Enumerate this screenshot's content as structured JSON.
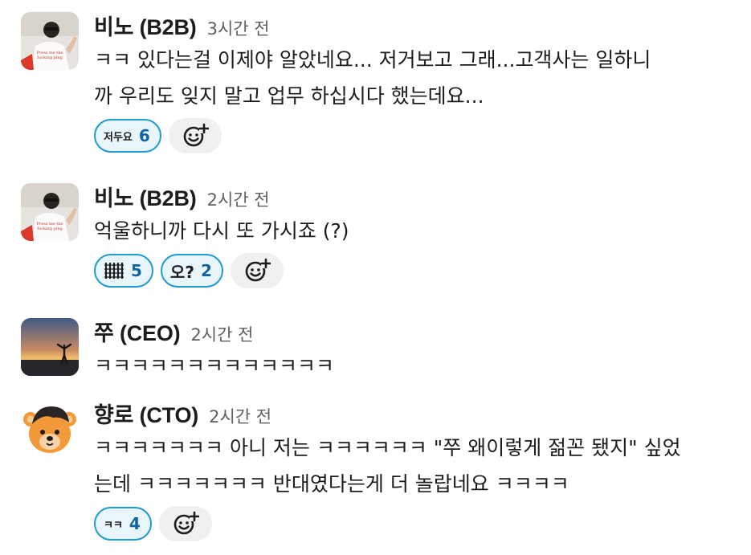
{
  "messages": [
    {
      "author": "비노 (B2B)",
      "time": "3시간 전",
      "text": "ㅋㅋ 있다는걸 이제야 알았네요... 저거보고 그래...고객사는 일하니\n까 우리도 잊지 말고 업무 하십시다 했는데요...",
      "avatar": "person-photo",
      "reactions": [
        {
          "emoji_text": "저두요",
          "count": "6"
        }
      ]
    },
    {
      "author": "비노 (B2B)",
      "time": "2시간 전",
      "text": "억울하니까 다시 또 가시죠 (?)",
      "avatar": "person-photo",
      "reactions": [
        {
          "emoji_text": "",
          "icon": "stacked-lines-icon",
          "count": "5"
        },
        {
          "emoji_text": "오?",
          "count": "2"
        }
      ]
    },
    {
      "author": "쭈 (CEO)",
      "time": "2시간 전",
      "text": "ㅋㅋㅋㅋㅋㅋㅋㅋㅋㅋㅋㅋㅋ",
      "avatar": "sunset-photo",
      "reactions": []
    },
    {
      "author": "향로 (CTO)",
      "time": "2시간 전",
      "text": "ㅋㅋㅋㅋㅋㅋㅋ 아니 저는 ㅋㅋㅋㅋㅋㅋ \"쭈 왜이렇게 젊꼰 됐지\" 싶었\n는데 ㅋㅋㅋㅋㅋㅋㅋ 반대였다는게 더 놀랍네요 ㅋㅋㅋㅋ",
      "avatar": "bear-avatar",
      "reactions": [
        {
          "emoji_text": "ㅋㅋ",
          "count": "4"
        }
      ]
    }
  ],
  "colors": {
    "reaction_border": "#1d9bd1",
    "reaction_bg": "#e8f5fa",
    "reaction_count": "#1264a3",
    "add_reaction_bg": "#f0f0f0",
    "timestamp": "#616061"
  },
  "icons": {
    "add_reaction": "add-reaction-icon"
  }
}
